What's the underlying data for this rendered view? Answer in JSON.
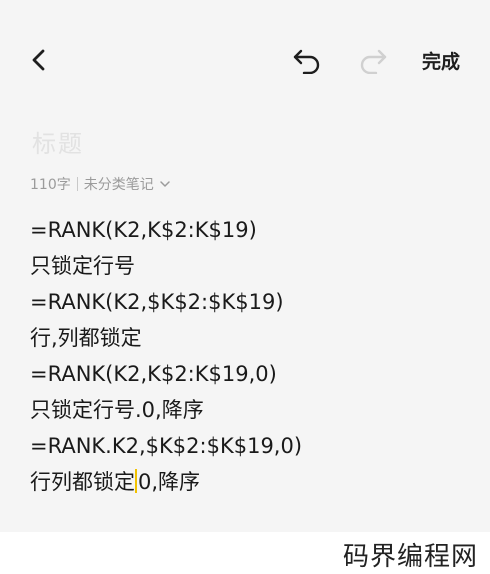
{
  "status_bar": {
    "time": "· ·· ·",
    "indicators": "·· ·· ·· ·"
  },
  "toolbar": {
    "back_icon": "chevron-left-icon",
    "undo_icon": "undo-icon",
    "redo_icon": "redo-icon",
    "done_label": "完成"
  },
  "note": {
    "title_placeholder": "标题",
    "char_count": "110字",
    "category": "未分类笔记",
    "lines": [
      "=RANK(K2,K$2:K$19)",
      "只锁定行号",
      "=RANK(K2,$K$2:$K$19)",
      "行,列都锁定",
      "=RANK(K2,K$2:K$19,0)",
      "只锁定行号.0,降序",
      "=RANK.K2,$K$2:$K$19,0)"
    ],
    "last_line_before_cursor": "行列都锁定",
    "last_line_after_cursor": "0,降序"
  },
  "footer": {
    "watermark": "码界编程网"
  },
  "colors": {
    "cursor": "#f2c200",
    "redo_disabled": "#d0d0d0"
  }
}
